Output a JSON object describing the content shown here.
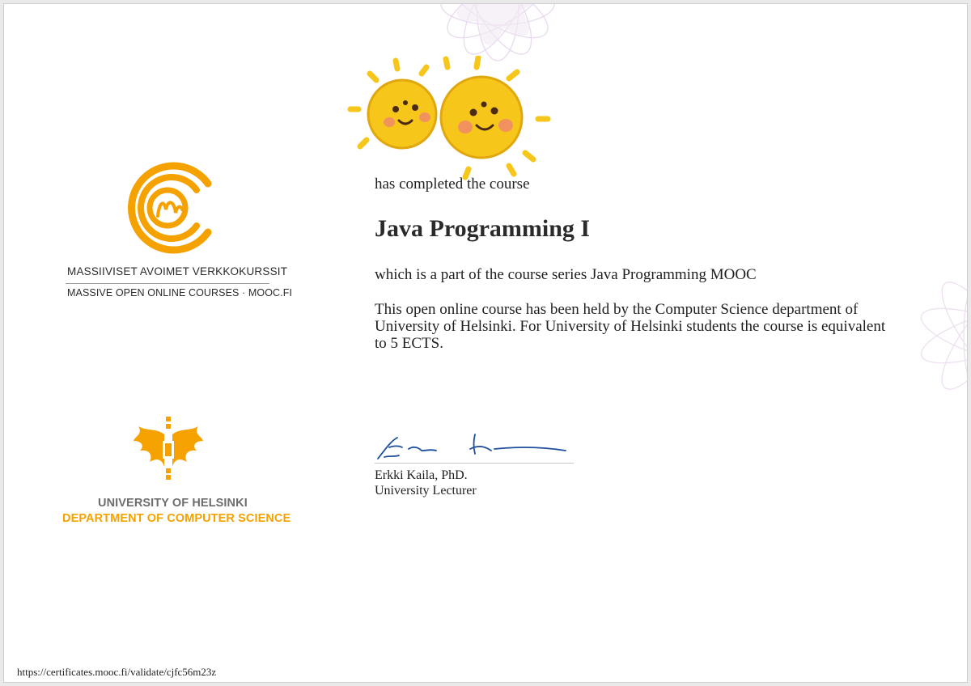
{
  "logos": {
    "mooc_line1": "MASSIIVISET AVOIMET VERKKOKURSSIT",
    "mooc_line2": "MASSIVE OPEN ONLINE COURSES · MOOC.FI",
    "uh_line1": "UNIVERSITY OF HELSINKI",
    "uh_line2": "DEPARTMENT OF COMPUTER SCIENCE"
  },
  "certificate": {
    "completed_text": "has completed the course",
    "course_title": "Java Programming I",
    "series_text": "which is a part of the course series Java Programming MOOC",
    "description": "This open online course has been held by the Computer Science department of University of Helsinki. For University of Helsinki students the course is equivalent to 5 ECTS."
  },
  "signer": {
    "name": "Erkki Kaila, PhD.",
    "title": "University Lecturer"
  },
  "validation_url": "https://certificates.mooc.fi/validate/cjfc56m23z",
  "colors": {
    "orange": "#f5a200",
    "signature_blue": "#1f4f9c",
    "sun_yellow": "#f7c61a"
  }
}
